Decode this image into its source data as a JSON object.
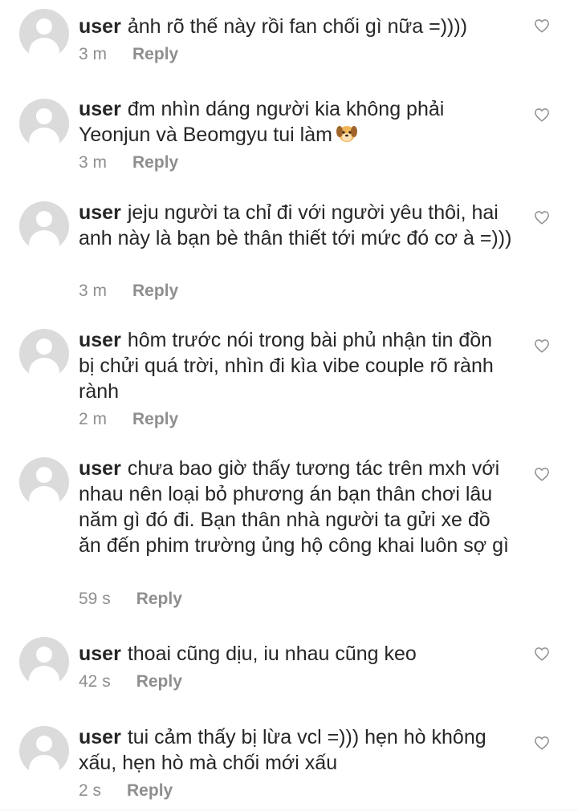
{
  "comments": [
    {
      "username": "user",
      "text": "ảnh rõ thế này rồi fan chối gì nữa =))))",
      "time": "3 m",
      "reply_label": "Reply",
      "emoji": ""
    },
    {
      "username": "user",
      "text": "đm nhìn dáng người kia không phải Yeonjun và Beomgyu tui làm",
      "time": "3 m",
      "reply_label": "Reply",
      "emoji": "dog-face-emoji"
    },
    {
      "username": "user",
      "text": "jeju người ta chỉ đi với người yêu thôi, hai anh này là bạn bè thân thiết tới mức đó cơ à =)))",
      "time": "3 m",
      "reply_label": "Reply",
      "emoji": ""
    },
    {
      "username": "user",
      "text": "hôm trước nói trong bài phủ nhận tin đồn bị chửi quá trời, nhìn đi kìa vibe couple rõ rành rành",
      "time": "2 m",
      "reply_label": "Reply",
      "emoji": ""
    },
    {
      "username": "user",
      "text": "chưa bao giờ thấy tương tác trên mxh với nhau nên loại bỏ phương án bạn thân chơi lâu năm gì đó đi. Bạn thân nhà người ta gửi xe đồ ăn đến phim trường ủng hộ công khai luôn sợ gì",
      "time": "59 s",
      "reply_label": "Reply",
      "emoji": ""
    },
    {
      "username": "user",
      "text": "thoai cũng dịu, iu nhau cũng keo",
      "time": "42 s",
      "reply_label": "Reply",
      "emoji": ""
    },
    {
      "username": "user",
      "text": "tui cảm thấy bị lừa vcl =))) hẹn hò không xấu, hẹn hò mà chối mới xấu",
      "time": "2 s",
      "reply_label": "Reply",
      "emoji": ""
    }
  ],
  "icons": {
    "avatar": "default-avatar-icon",
    "like": "heart-outline-icon"
  },
  "colors": {
    "text": "#262626",
    "secondary": "#8e8e8e",
    "avatar_bg": "#dbdbdb"
  }
}
